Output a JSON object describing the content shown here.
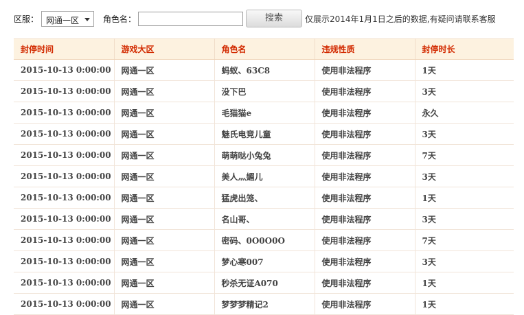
{
  "filter": {
    "region_label": "区服：",
    "region_value": "网通一区",
    "name_label": "角色名：",
    "name_value": "",
    "search_button": "搜索",
    "notice": "仅展示2014年1月1日之后的数据,有疑问请联系客服"
  },
  "table": {
    "headers": [
      "封停时间",
      "游戏大区",
      "角色名",
      "违规性质",
      "封停时长"
    ],
    "rows": [
      [
        "2015-10-13 0:00:00",
        "网通一区",
        "蚂蚁、63C8",
        "使用非法程序",
        "1天"
      ],
      [
        "2015-10-13 0:00:00",
        "网通一区",
        "没下巴",
        "使用非法程序",
        "3天"
      ],
      [
        "2015-10-13 0:00:00",
        "网通一区",
        "毛猫猫e",
        "使用非法程序",
        "永久"
      ],
      [
        "2015-10-13 0:00:00",
        "网通一区",
        "魅氏电竞儿童",
        "使用非法程序",
        "3天"
      ],
      [
        "2015-10-13 0:00:00",
        "网通一区",
        "萌萌哒小兔兔",
        "使用非法程序",
        "7天"
      ],
      [
        "2015-10-13 0:00:00",
        "网通一区",
        "美人灬媚儿",
        "使用非法程序",
        "3天"
      ],
      [
        "2015-10-13 0:00:00",
        "网通一区",
        "猛虎出笼、",
        "使用非法程序",
        "1天"
      ],
      [
        "2015-10-13 0:00:00",
        "网通一区",
        "名山哥、",
        "使用非法程序",
        "3天"
      ],
      [
        "2015-10-13 0:00:00",
        "网通一区",
        "密码、0O0O0O",
        "使用非法程序",
        "7天"
      ],
      [
        "2015-10-13 0:00:00",
        "网通一区",
        "梦心寒007",
        "使用非法程序",
        "3天"
      ],
      [
        "2015-10-13 0:00:00",
        "网通一区",
        "秒杀无证A070",
        "使用非法程序",
        "1天"
      ],
      [
        "2015-10-13 0:00:00",
        "网通一区",
        "梦梦梦精记2",
        "使用非法程序",
        "1天"
      ]
    ]
  },
  "colors": {
    "header_background": "#fdf2e0",
    "header_text": "#d22a00",
    "grid_line": "#f1e4d8"
  }
}
